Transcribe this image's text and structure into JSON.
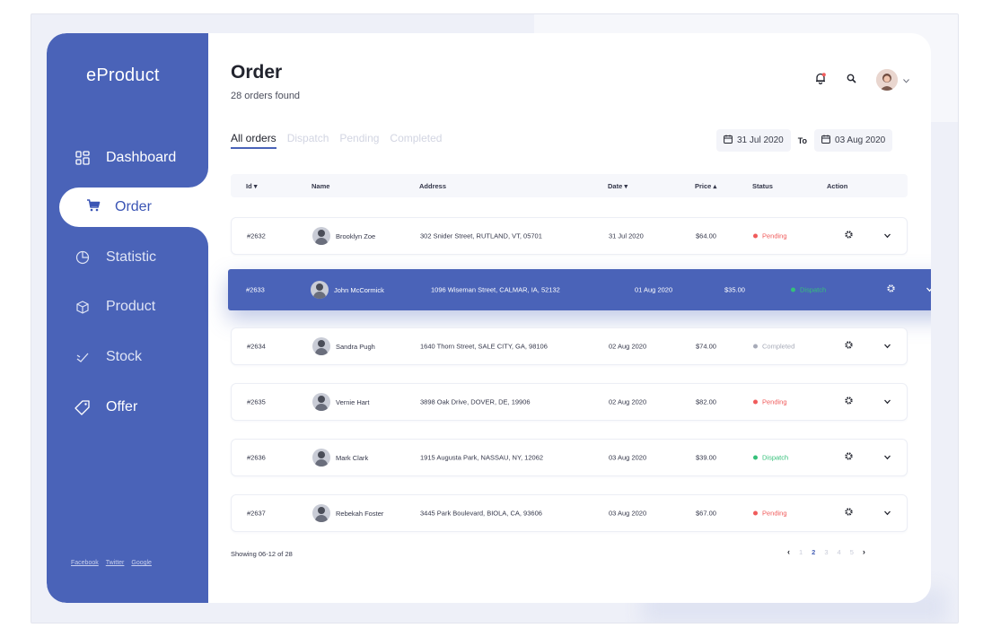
{
  "app": {
    "brand": "eProduct"
  },
  "sidebar": {
    "items": [
      {
        "label": "Dashboard",
        "icon": "dashboard-icon"
      },
      {
        "label": "Order",
        "icon": "cart-icon",
        "active": true
      },
      {
        "label": "Statistic",
        "icon": "pie-chart-icon"
      },
      {
        "label": "Product",
        "icon": "box-icon"
      },
      {
        "label": "Stock",
        "icon": "stock-icon"
      },
      {
        "label": "Offer",
        "icon": "tag-icon"
      }
    ],
    "footer": [
      "Facebook",
      "Twitter",
      "Google"
    ]
  },
  "header": {
    "title": "Order",
    "subtitle": "28 orders found",
    "icons": [
      "bell-icon",
      "search-icon",
      "avatar",
      "chevron-down-icon"
    ]
  },
  "tabs": [
    {
      "label": "All orders",
      "active": true
    },
    {
      "label": "Dispatch"
    },
    {
      "label": "Pending"
    },
    {
      "label": "Completed"
    }
  ],
  "date_range": {
    "from": "31 Jul 2020",
    "to_label": "To",
    "to": "03 Aug 2020"
  },
  "table": {
    "columns": [
      "Id",
      "Name",
      "Address",
      "Date",
      "Price",
      "Status",
      "Action"
    ],
    "rows": [
      {
        "id": "#2632",
        "name": "Brooklyn Zoe",
        "address": "302 Snider Street, RUTLAND, VT, 05701",
        "date": "31 Jul 2020",
        "price": "$64.00",
        "status": "Pending"
      },
      {
        "id": "#2633",
        "name": "John McCormick",
        "address": "1096 Wiseman Street, CALMAR, IA, 52132",
        "date": "01 Aug 2020",
        "price": "$35.00",
        "status": "Dispatch"
      },
      {
        "id": "#2634",
        "name": "Sandra Pugh",
        "address": "1640 Thorn Street, SALE CITY, GA, 98106",
        "date": "02 Aug 2020",
        "price": "$74.00",
        "status": "Completed"
      },
      {
        "id": "#2635",
        "name": "Vernie Hart",
        "address": "3898 Oak Drive, DOVER, DE, 19906",
        "date": "02 Aug 2020",
        "price": "$82.00",
        "status": "Pending"
      },
      {
        "id": "#2636",
        "name": "Mark Clark",
        "address": "1915 Augusta Park, NASSAU, NY, 12062",
        "date": "03 Aug 2020",
        "price": "$39.00",
        "status": "Dispatch"
      },
      {
        "id": "#2637",
        "name": "Rebekah Foster",
        "address": "3445 Park Boulevard, BIOLA, CA, 93606",
        "date": "03 Aug 2020",
        "price": "$67.00",
        "status": "Pending"
      }
    ]
  },
  "footer": {
    "showing": "Showing 06-12 of 28",
    "pages": [
      "1",
      "2",
      "3",
      "4",
      "5"
    ],
    "current_page": "2"
  },
  "colors": {
    "brand": "#4a63b8",
    "pending": "#f05b5b",
    "dispatch": "#35c07a",
    "completed": "#a7abb8"
  }
}
